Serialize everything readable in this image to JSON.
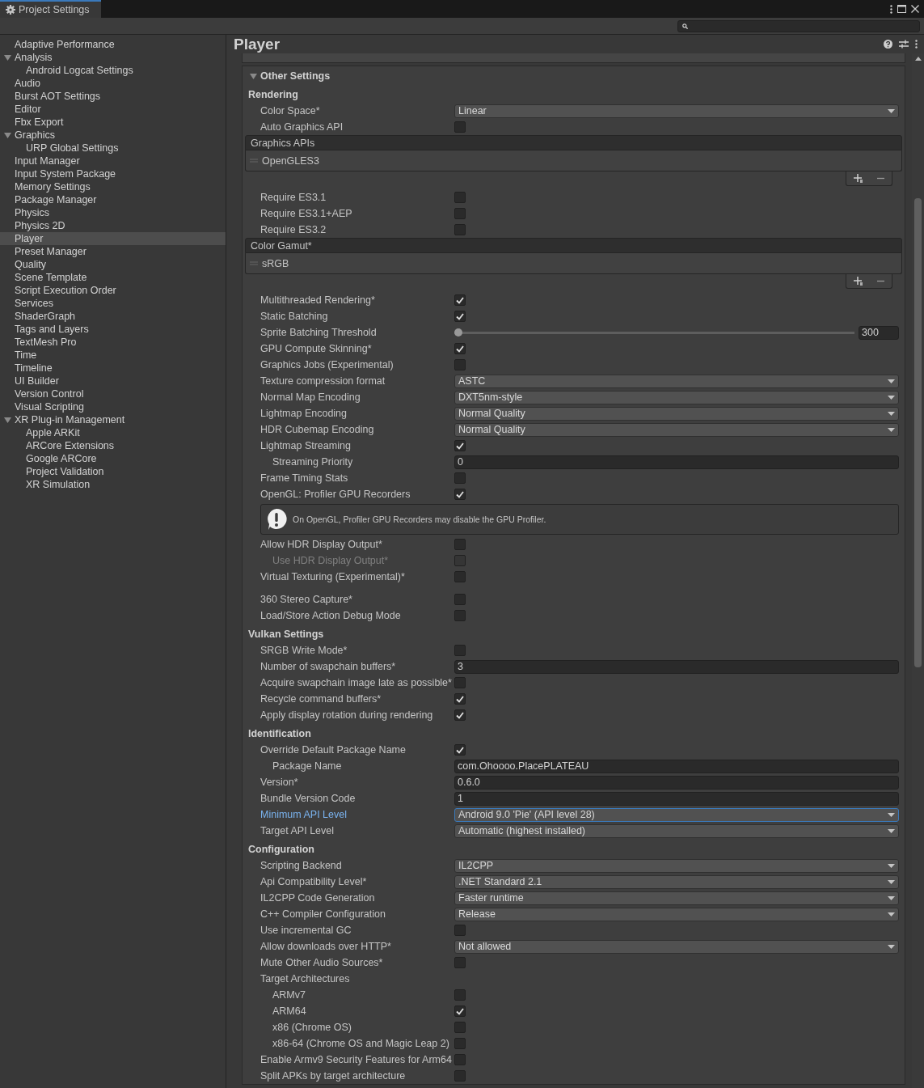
{
  "window": {
    "tab": "Project Settings"
  },
  "sidebar": {
    "items": [
      {
        "label": "Adaptive Performance",
        "selected": false
      },
      {
        "label": "Analysis",
        "selected": false,
        "expanded": true,
        "children": [
          {
            "label": "Android Logcat Settings",
            "selected": false
          }
        ]
      },
      {
        "label": "Audio",
        "selected": false
      },
      {
        "label": "Burst AOT Settings",
        "selected": false
      },
      {
        "label": "Editor",
        "selected": false
      },
      {
        "label": "Fbx Export",
        "selected": false
      },
      {
        "label": "Graphics",
        "selected": false,
        "expanded": true,
        "children": [
          {
            "label": "URP Global Settings",
            "selected": false
          }
        ]
      },
      {
        "label": "Input Manager",
        "selected": false
      },
      {
        "label": "Input System Package",
        "selected": false
      },
      {
        "label": "Memory Settings",
        "selected": false
      },
      {
        "label": "Package Manager",
        "selected": false
      },
      {
        "label": "Physics",
        "selected": false
      },
      {
        "label": "Physics 2D",
        "selected": false
      },
      {
        "label": "Player",
        "selected": true
      },
      {
        "label": "Preset Manager",
        "selected": false
      },
      {
        "label": "Quality",
        "selected": false
      },
      {
        "label": "Scene Template",
        "selected": false
      },
      {
        "label": "Script Execution Order",
        "selected": false
      },
      {
        "label": "Services",
        "selected": false
      },
      {
        "label": "ShaderGraph",
        "selected": false
      },
      {
        "label": "Tags and Layers",
        "selected": false
      },
      {
        "label": "TextMesh Pro",
        "selected": false
      },
      {
        "label": "Time",
        "selected": false
      },
      {
        "label": "Timeline",
        "selected": false
      },
      {
        "label": "UI Builder",
        "selected": false
      },
      {
        "label": "Version Control",
        "selected": false
      },
      {
        "label": "Visual Scripting",
        "selected": false
      },
      {
        "label": "XR Plug-in Management",
        "selected": false,
        "expanded": true,
        "children": [
          {
            "label": "Apple ARKit",
            "selected": false
          },
          {
            "label": "ARCore Extensions",
            "selected": false
          },
          {
            "label": "Google ARCore",
            "selected": false
          },
          {
            "label": "Project Validation",
            "selected": false
          },
          {
            "label": "XR Simulation",
            "selected": false
          }
        ]
      }
    ]
  },
  "inspector": {
    "title": "Player",
    "section": {
      "title": "Other Settings",
      "expanded": true,
      "rows": [
        {
          "kind": "header",
          "label": "Rendering"
        },
        {
          "kind": "dropdown",
          "label": "Color Space*",
          "value": "Linear",
          "focused": false
        },
        {
          "kind": "checkbox",
          "label": "Auto Graphics API",
          "checked": false
        },
        {
          "kind": "list",
          "title": "Graphics APIs",
          "items": [
            "OpenGLES3"
          ]
        },
        {
          "kind": "checkbox",
          "label": "Require ES3.1",
          "checked": false
        },
        {
          "kind": "checkbox",
          "label": "Require ES3.1+AEP",
          "checked": false
        },
        {
          "kind": "checkbox",
          "label": "Require ES3.2",
          "checked": false
        },
        {
          "kind": "list",
          "title": "Color Gamut*",
          "items": [
            "sRGB"
          ]
        },
        {
          "kind": "checkbox",
          "label": "Multithreaded Rendering*",
          "checked": true
        },
        {
          "kind": "checkbox",
          "label": "Static Batching",
          "checked": true
        },
        {
          "kind": "slider",
          "label": "Sprite Batching Threshold",
          "level": 0,
          "value": "300"
        },
        {
          "kind": "checkbox",
          "label": "GPU Compute Skinning*",
          "checked": true
        },
        {
          "kind": "checkbox",
          "label": "Graphics Jobs (Experimental)",
          "checked": false
        },
        {
          "kind": "dropdown",
          "label": "Texture compression format",
          "value": "ASTC",
          "focused": false
        },
        {
          "kind": "dropdown",
          "label": "Normal Map Encoding",
          "value": "DXT5nm-style",
          "focused": false
        },
        {
          "kind": "dropdown",
          "label": "Lightmap Encoding",
          "value": "Normal Quality",
          "focused": false
        },
        {
          "kind": "dropdown",
          "label": "HDR Cubemap Encoding",
          "value": "Normal Quality",
          "focused": false
        },
        {
          "kind": "checkbox",
          "label": "Lightmap Streaming",
          "checked": true,
          "children": [
            {
              "kind": "field",
              "label": "Streaming Priority",
              "value": "0"
            }
          ]
        },
        {
          "kind": "checkbox",
          "label": "Frame Timing Stats",
          "checked": false
        },
        {
          "kind": "checkbox",
          "label": "OpenGL: Profiler GPU Recorders",
          "checked": true
        },
        {
          "kind": "help",
          "text": "On OpenGL, Profiler GPU Recorders may disable the GPU Profiler."
        },
        {
          "kind": "checkbox",
          "label": "Allow HDR Display Output*",
          "checked": false,
          "children": [
            {
              "kind": "checkbox",
              "label": "Use HDR Display Output*",
              "checked": false,
              "disabled": true
            }
          ]
        },
        {
          "kind": "checkbox",
          "label": "Virtual Texturing (Experimental)*",
          "checked": false
        },
        {
          "kind": "gap"
        },
        {
          "kind": "checkbox",
          "label": "360 Stereo Capture*",
          "checked": false
        },
        {
          "kind": "checkbox",
          "label": "Load/Store Action Debug Mode",
          "checked": false
        },
        {
          "kind": "header",
          "label": "Vulkan Settings"
        },
        {
          "kind": "checkbox",
          "label": "SRGB Write Mode*",
          "checked": false
        },
        {
          "kind": "field",
          "label": "Number of swapchain buffers*",
          "value": "3"
        },
        {
          "kind": "checkbox",
          "label": "Acquire swapchain image late as possible*",
          "checked": false
        },
        {
          "kind": "checkbox",
          "label": "Recycle command buffers*",
          "checked": true
        },
        {
          "kind": "checkbox",
          "label": "Apply display rotation during rendering",
          "checked": true
        },
        {
          "kind": "header",
          "label": "Identification"
        },
        {
          "kind": "checkbox",
          "label": "Override Default Package Name",
          "checked": true,
          "children": [
            {
              "kind": "field",
              "label": "Package Name",
              "value": "com.Ohoooo.PlacePLATEAU"
            }
          ]
        },
        {
          "kind": "field",
          "label": "Version*",
          "value": "0.6.0"
        },
        {
          "kind": "field",
          "label": "Bundle Version Code",
          "value": "1"
        },
        {
          "kind": "dropdown",
          "label": "Minimum API Level",
          "value": "Android 9.0 'Pie' (API level 28)",
          "focused": true
        },
        {
          "kind": "dropdown",
          "label": "Target API Level",
          "value": "Automatic (highest installed)",
          "focused": false
        },
        {
          "kind": "header",
          "label": "Configuration"
        },
        {
          "kind": "dropdown",
          "label": "Scripting Backend",
          "value": "IL2CPP",
          "focused": false
        },
        {
          "kind": "dropdown",
          "label": "Api Compatibility Level*",
          "value": ".NET Standard 2.1",
          "focused": false
        },
        {
          "kind": "dropdown",
          "label": "IL2CPP Code Generation",
          "value": "Faster runtime",
          "focused": false
        },
        {
          "kind": "dropdown",
          "label": "C++ Compiler Configuration",
          "value": "Release",
          "focused": false
        },
        {
          "kind": "checkbox",
          "label": "Use incremental GC",
          "checked": false
        },
        {
          "kind": "dropdown",
          "label": "Allow downloads over HTTP*",
          "value": "Not allowed",
          "focused": false
        },
        {
          "kind": "checkbox",
          "label": "Mute Other Audio Sources*",
          "checked": false
        },
        {
          "kind": "label",
          "label": "Target Architectures",
          "children": [
            {
              "kind": "checkbox",
              "label": "ARMv7",
              "checked": false
            },
            {
              "kind": "checkbox",
              "label": "ARM64",
              "checked": true
            },
            {
              "kind": "checkbox",
              "label": "x86 (Chrome OS)",
              "checked": false
            },
            {
              "kind": "checkbox",
              "label": "x86-64 (Chrome OS and Magic Leap 2)",
              "checked": false
            }
          ]
        },
        {
          "kind": "checkbox",
          "label": "Enable Armv9 Security Features for Arm64",
          "checked": false
        },
        {
          "kind": "checkbox",
          "label": "Split APKs by target architecture",
          "checked": false
        }
      ]
    }
  }
}
